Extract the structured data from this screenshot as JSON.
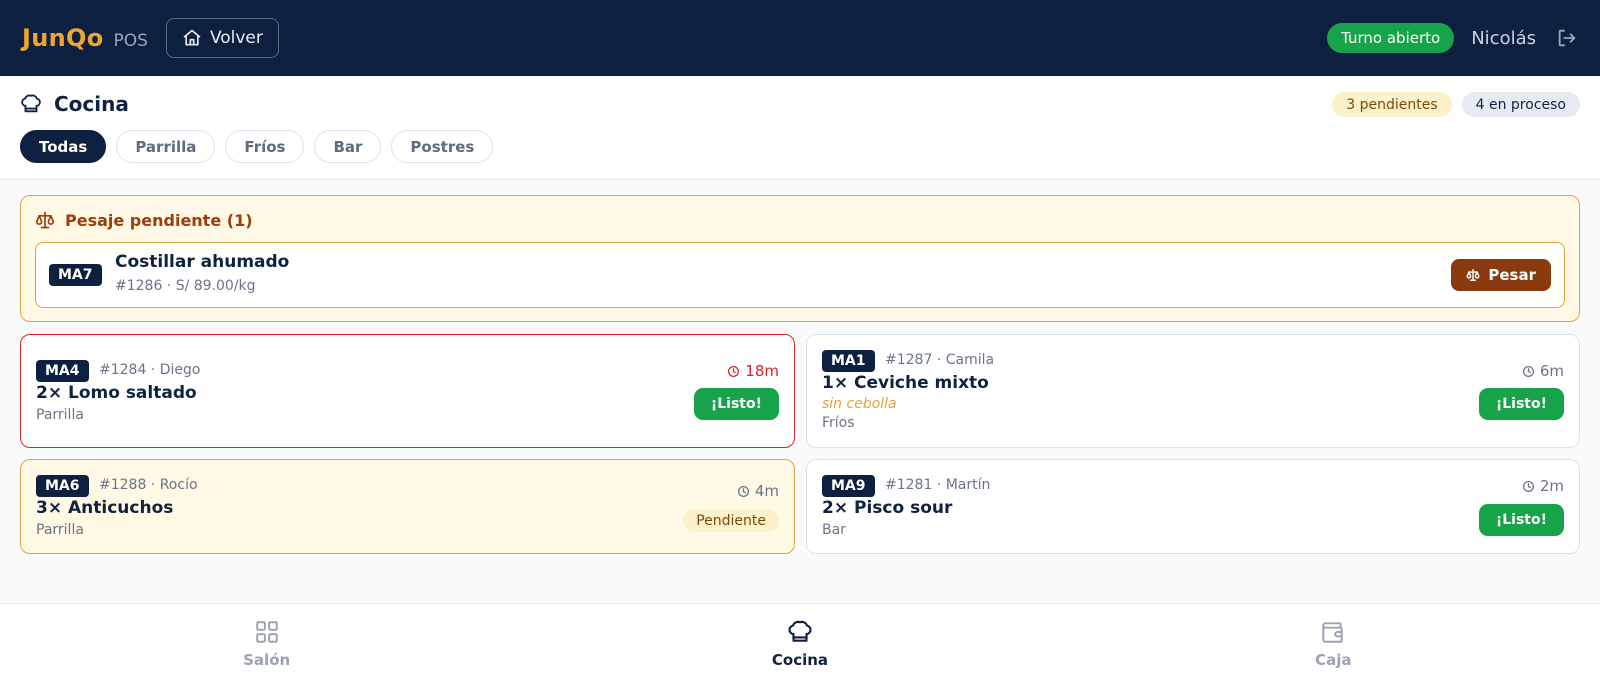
{
  "app": {
    "brand": "JunQo",
    "brand_sub": "POS",
    "back_label": "Volver"
  },
  "status": {
    "shift": "Turno abierto",
    "user": "Nicolás"
  },
  "section": {
    "title": "Cocina",
    "pending_count": "3 pendientes",
    "process_count": "4 en proceso"
  },
  "filters": [
    "Todas",
    "Parrilla",
    "Fríos",
    "Bar",
    "Postres"
  ],
  "weighing": {
    "title": "Pesaje pendiente (1)",
    "item": {
      "table": "MA7",
      "name": "Costillar ahumado",
      "meta": "#1286 · S/ 89.00/kg",
      "button": "Pesar"
    }
  },
  "orders": [
    {
      "table": "MA4",
      "meta": "#1284 · Diego",
      "dish": "2× Lomo saltado",
      "station": "Parrilla",
      "time": "18m",
      "action": "¡Listo!"
    },
    {
      "table": "MA1",
      "meta": "#1287 · Camila",
      "dish": "1× Ceviche mixto",
      "note": "sin cebolla",
      "station": "Fríos",
      "time": "6m",
      "action": "¡Listo!"
    },
    {
      "table": "MA6",
      "meta": "#1288 · Rocío",
      "dish": "3× Anticuchos",
      "station": "Parrilla",
      "time": "4m",
      "status": "Pendiente"
    },
    {
      "table": "MA9",
      "meta": "#1281 · Martín",
      "dish": "2× Pisco sour",
      "station": "Bar",
      "time": "2m",
      "action": "¡Listo!"
    }
  ],
  "nav": [
    "Salón",
    "Cocina",
    "Caja"
  ],
  "colors": {
    "navy": "#0d2040",
    "brand_orange": "#f0a530",
    "success_green": "#16a34a",
    "alert_red": "#dc2626",
    "amber": "#e6a23c",
    "weigh_brown": "#8b3a0f"
  },
  "icons": [
    "home-icon",
    "logout-icon",
    "chef-hat-icon",
    "scale-icon",
    "clock-icon",
    "grid-icon",
    "wallet-icon"
  ]
}
